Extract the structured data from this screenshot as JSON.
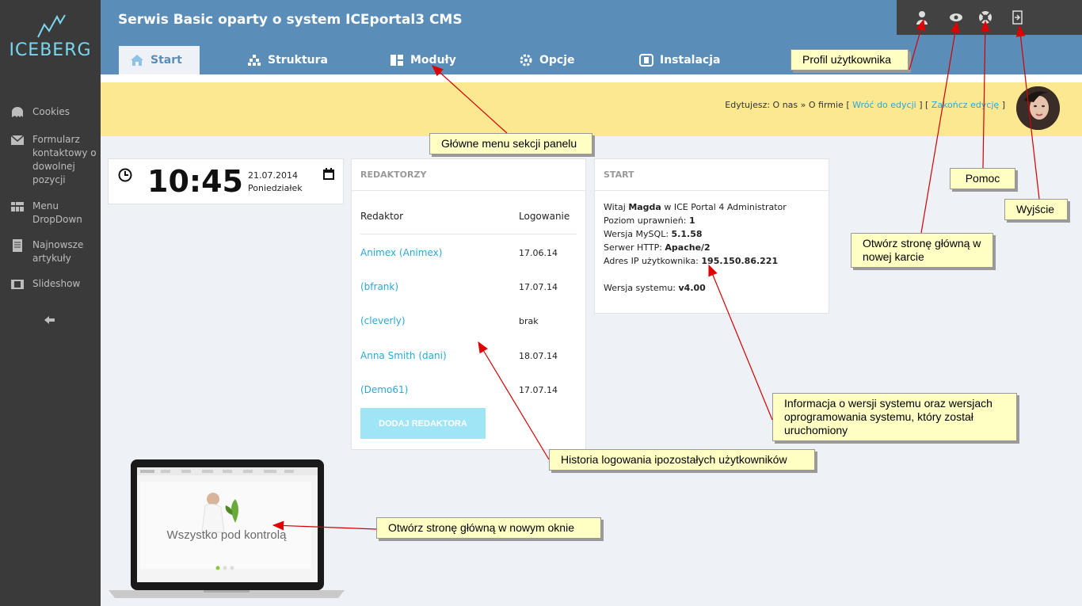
{
  "app": {
    "title": "Serwis Basic oparty o system ICEportal3 CMS",
    "logo": "ICEBERG"
  },
  "sidebar": {
    "items": [
      {
        "label": "Cookies",
        "icon": "cookie-icon"
      },
      {
        "label": "Formularz kontaktowy o dowolnej pozycji",
        "icon": "envelope-icon"
      },
      {
        "label": "Menu DropDown",
        "icon": "menu-grid-icon"
      },
      {
        "label": "Najnowsze artykuły",
        "icon": "document-icon"
      },
      {
        "label": "Slideshow",
        "icon": "film-icon"
      }
    ]
  },
  "tabs": [
    {
      "label": "Start",
      "icon": "home-icon"
    },
    {
      "label": "Struktura",
      "icon": "sitemap-icon"
    },
    {
      "label": "Moduły",
      "icon": "modules-icon"
    },
    {
      "label": "Opcje",
      "icon": "gear-icon"
    },
    {
      "label": "Instalacja",
      "icon": "install-icon"
    }
  ],
  "edit_bar": {
    "prefix": "Edytujesz: O nas » O firmie [",
    "back_link": "Wróć do edycji",
    "mid": "] [",
    "end_link": "Zakończ edycję",
    "suffix": "]"
  },
  "clock": {
    "time": "10:45",
    "date": "21.07.2014",
    "weekday": "Poniedziałek"
  },
  "editors": {
    "title": "REDAKTORZY",
    "col_editor": "Redaktor",
    "col_login": "Logowanie",
    "rows": [
      {
        "name": "Animex (Animex)",
        "date": "17.06.14"
      },
      {
        "name": "(bfrank)",
        "date": "17.07.14"
      },
      {
        "name": "(cleverly)",
        "date": "brak"
      },
      {
        "name": "Anna Smith (dani)",
        "date": "18.07.14"
      },
      {
        "name": "(Demo61)",
        "date": "17.07.14"
      }
    ],
    "add_button": "DODAJ REDAKTORA"
  },
  "start": {
    "title": "START",
    "welcome_pre": "Witaj",
    "user": "Magda",
    "welcome_post": "w ICE Portal 4 Administrator",
    "level_label": "Poziom uprawnień:",
    "level": "1",
    "mysql_label": "Wersja MySQL:",
    "mysql": "5.1.58",
    "http_label": "Serwer HTTP:",
    "http": "Apache/2",
    "ip_label": "Adres IP użytkownika:",
    "ip": "195.150.86.221",
    "version_label": "Wersja systemu:",
    "version": "v4.00"
  },
  "preview": {
    "slogan": "Wszystko pod kontrolą"
  },
  "callouts": {
    "profile": "Profil użytkownika",
    "main_menu": "Główne menu sekcji panelu",
    "help": "Pomoc",
    "exit": "Wyjście",
    "open_tab": "Otwórz stronę główną w nowej karcie",
    "version_info": "Informacja o wersji systemu oraz wersjach oprogramowania systemu, który został uruchomiony",
    "login_history": "Historia logowania ipozostałych użytkowników",
    "open_window": "Otwórz stronę główną w nowym oknie"
  },
  "colors": {
    "topbar": "#5a8db8",
    "sidebar": "#3a3a3a",
    "accent": "#2aa7d6",
    "yellow_bar": "#fbe891",
    "callout": "#ffffc4"
  }
}
